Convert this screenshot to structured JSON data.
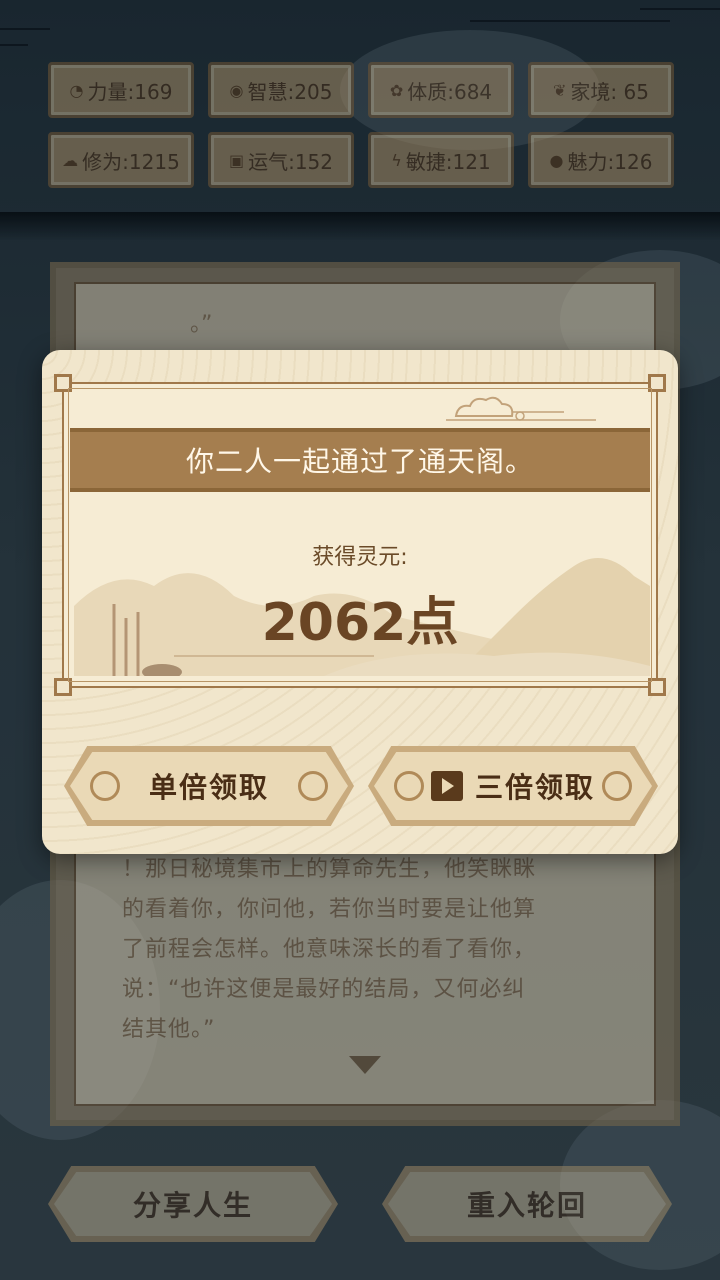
{
  "stats": [
    {
      "icon": "strength-icon",
      "glyph": "◔",
      "label": "力量:169"
    },
    {
      "icon": "wisdom-icon",
      "glyph": "◉",
      "label": "智慧:205"
    },
    {
      "icon": "constitution-icon",
      "glyph": "✿",
      "label": "体质:684"
    },
    {
      "icon": "family-icon",
      "glyph": "❦",
      "label": "家境: 65"
    },
    {
      "icon": "cultivation-icon",
      "glyph": "☁",
      "label": "修为:1215"
    },
    {
      "icon": "luck-icon",
      "glyph": "▣",
      "label": "运气:152"
    },
    {
      "icon": "agility-icon",
      "glyph": "ϟ",
      "label": "敏捷:121"
    },
    {
      "icon": "charm-icon",
      "glyph": "●",
      "label": "魅力:126"
    }
  ],
  "story": {
    "top_fragment": "。”",
    "lines": [
      "！那日秘境集市上的算命先生，他笑眯眯",
      "的看着你，你问他，若你当时要是让他算",
      "了前程会怎样。他意味深长的看了看你，",
      "说：“也许这便是最好的结局，又何必纠",
      "结其他。”"
    ]
  },
  "modal": {
    "title": "你二人一起通过了通天阁。",
    "reward_label": "获得灵元:",
    "reward_value": "2062点",
    "single_button": "单倍领取",
    "triple_button": "三倍领取"
  },
  "bottom": {
    "share_button": "分享人生",
    "restart_button": "重入轮回"
  }
}
